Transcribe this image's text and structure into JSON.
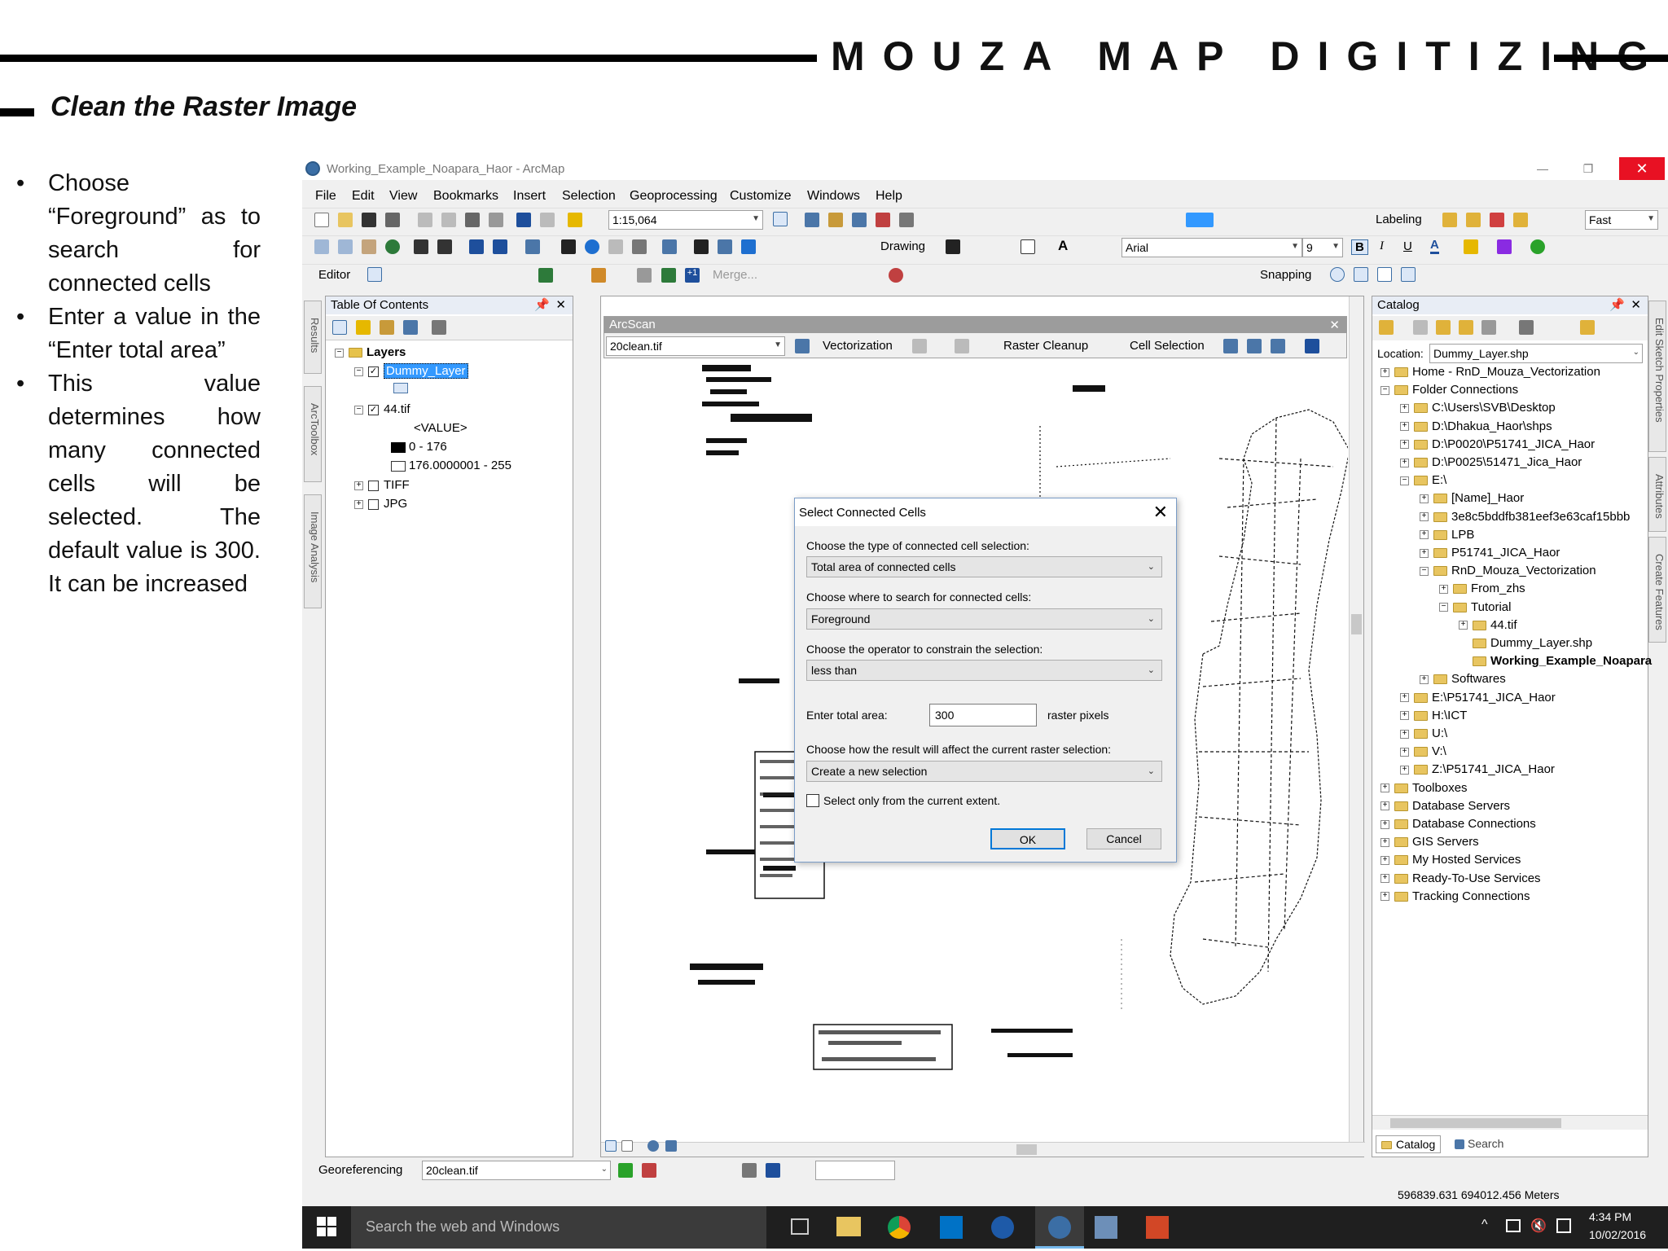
{
  "slide": {
    "title": "MOUZA MAP DIGITIZING",
    "subtitle": "Clean the Raster Image",
    "bullets": [
      "Choose “Foreground” as to search for connected cells",
      "Enter a value in the “Enter total area”",
      "This value determines how many connected cells will be selected. The default value is 300. It can be increased"
    ]
  },
  "app": {
    "window_title": "Working_Example_Noapara_Haor - ArcMap",
    "menu": [
      "File",
      "Edit",
      "View",
      "Bookmarks",
      "Insert",
      "Selection",
      "Geoprocessing",
      "Customize",
      "Windows",
      "Help"
    ],
    "scale": "1:15,064",
    "labeling": "Labeling",
    "fast": "Fast",
    "drawing": "Drawing",
    "font_name": "Arial",
    "font_size": "9",
    "editor": "Editor",
    "merge": "Merge...",
    "snapping": "Snapping",
    "georeferencing": "Georeferencing",
    "geo_layer": "20clean.tif",
    "coords": "596839.631  694012.456 Meters"
  },
  "toc": {
    "title": "Table Of Contents",
    "layers_label": "Layers",
    "dummy_layer": "Dummy_Layer",
    "raster": "44.tif",
    "value_label": "<VALUE>",
    "range1": "0 - 176",
    "range2": "176.0000001 - 255",
    "tiff": "TIFF",
    "jpg": "JPG"
  },
  "side_tabs": [
    "Results",
    "ArcToolbox",
    "Image Analysis"
  ],
  "right_tabs": [
    "Edit Sketch Properties",
    "Attributes",
    "Create Features"
  ],
  "arcscan": {
    "title": "ArcScan",
    "raster": "20clean.tif",
    "vectorization": "Vectorization",
    "raster_cleanup": "Raster Cleanup",
    "cell_selection": "Cell Selection"
  },
  "dialog": {
    "title": "Select Connected Cells",
    "label1": "Choose the type of connected cell selection:",
    "select1": "Total area of connected cells",
    "label2": "Choose where to search for connected cells:",
    "select2": "Foreground",
    "label3": "Choose the operator to constrain the selection:",
    "select3": "less than",
    "area_label": "Enter total area:",
    "area_value": "300",
    "area_unit": "raster pixels",
    "label4": "Choose how the result will affect the current raster selection:",
    "select4": "Create a new selection",
    "checkbox_label": "Select only from the current extent.",
    "ok": "OK",
    "cancel": "Cancel"
  },
  "catalog": {
    "title": "Catalog",
    "location_label": "Location:",
    "location_value": "Dummy_Layer.shp",
    "items": [
      {
        "text": "Home - RnD_Mouza_Vectorization",
        "indent": 0,
        "exp": "+"
      },
      {
        "text": "Folder Connections",
        "indent": 0,
        "exp": "−"
      },
      {
        "text": "C:\\Users\\SVB\\Desktop",
        "indent": 1,
        "exp": "+"
      },
      {
        "text": "D:\\Dhakua_Haor\\shps",
        "indent": 1,
        "exp": "+"
      },
      {
        "text": "D:\\P0020\\P51741_JICA_Haor",
        "indent": 1,
        "exp": "+"
      },
      {
        "text": "D:\\P0025\\51471_Jica_Haor",
        "indent": 1,
        "exp": "+"
      },
      {
        "text": "E:\\",
        "indent": 1,
        "exp": "−"
      },
      {
        "text": "[Name]_Haor",
        "indent": 2,
        "exp": "+"
      },
      {
        "text": "3e8c5bddfb381eef3e63caf15bbb",
        "indent": 2,
        "exp": "+"
      },
      {
        "text": "LPB",
        "indent": 2,
        "exp": "+"
      },
      {
        "text": "P51741_JICA_Haor",
        "indent": 2,
        "exp": "+"
      },
      {
        "text": "RnD_Mouza_Vectorization",
        "indent": 2,
        "exp": "−"
      },
      {
        "text": "From_zhs",
        "indent": 3,
        "exp": "+"
      },
      {
        "text": "Tutorial",
        "indent": 3,
        "exp": "−"
      },
      {
        "text": "44.tif",
        "indent": 4,
        "exp": "+"
      },
      {
        "text": "Dummy_Layer.shp",
        "indent": 4,
        "exp": ""
      },
      {
        "text": "Working_Example_Noapara",
        "indent": 4,
        "exp": "",
        "bold": true
      },
      {
        "text": "Softwares",
        "indent": 2,
        "exp": "+"
      },
      {
        "text": "E:\\P51741_JICA_Haor",
        "indent": 1,
        "exp": "+"
      },
      {
        "text": "H:\\ICT",
        "indent": 1,
        "exp": "+"
      },
      {
        "text": "U:\\",
        "indent": 1,
        "exp": "+"
      },
      {
        "text": "V:\\",
        "indent": 1,
        "exp": "+"
      },
      {
        "text": "Z:\\P51741_JICA_Haor",
        "indent": 1,
        "exp": "+"
      },
      {
        "text": "Toolboxes",
        "indent": 0,
        "exp": "+"
      },
      {
        "text": "Database Servers",
        "indent": 0,
        "exp": "+"
      },
      {
        "text": "Database Connections",
        "indent": 0,
        "exp": "+"
      },
      {
        "text": "GIS Servers",
        "indent": 0,
        "exp": "+"
      },
      {
        "text": "My Hosted Services",
        "indent": 0,
        "exp": "+"
      },
      {
        "text": "Ready-To-Use Services",
        "indent": 0,
        "exp": "+"
      },
      {
        "text": "Tracking Connections",
        "indent": 0,
        "exp": "+"
      }
    ],
    "tab_catalog": "Catalog",
    "tab_search": "Search"
  },
  "taskbar": {
    "search_placeholder": "Search the web and Windows",
    "time": "4:34 PM",
    "date": "10/02/2016"
  },
  "colors": {
    "close_red": "#e81123",
    "selection_blue": "#3399ff",
    "taskbar": "#1f1f1f"
  }
}
